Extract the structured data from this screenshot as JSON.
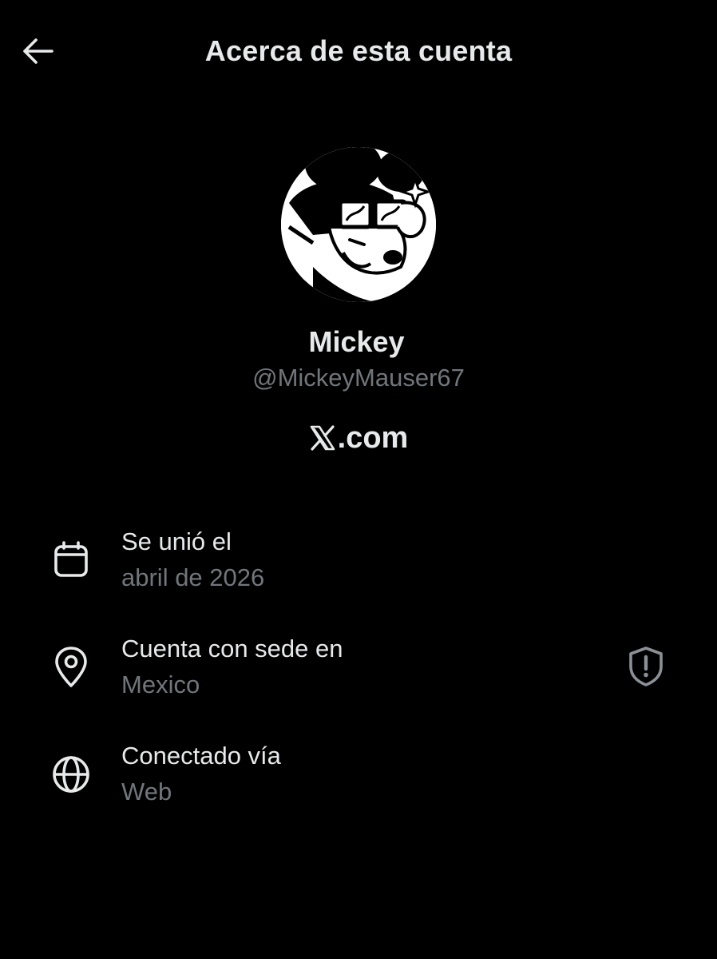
{
  "header": {
    "title": "Acerca de esta cuenta",
    "back_icon": "arrow-left-icon"
  },
  "profile": {
    "name": "Mickey",
    "handle": "@MickeyMauser67",
    "brand_mark": "𝕏",
    "brand_domain": ".com"
  },
  "details": [
    {
      "icon": "calendar-icon",
      "label": "Se unió el",
      "value": "abril de 2026"
    },
    {
      "icon": "location-pin-icon",
      "label": "Cuenta con sede en",
      "value": "Mexico",
      "action_icon": "shield-alert-icon"
    },
    {
      "icon": "globe-icon",
      "label": "Conectado vía",
      "value": "Web"
    }
  ],
  "colors": {
    "background": "#000000",
    "primary_text": "#e7e9ea",
    "secondary_text": "#71767b"
  }
}
